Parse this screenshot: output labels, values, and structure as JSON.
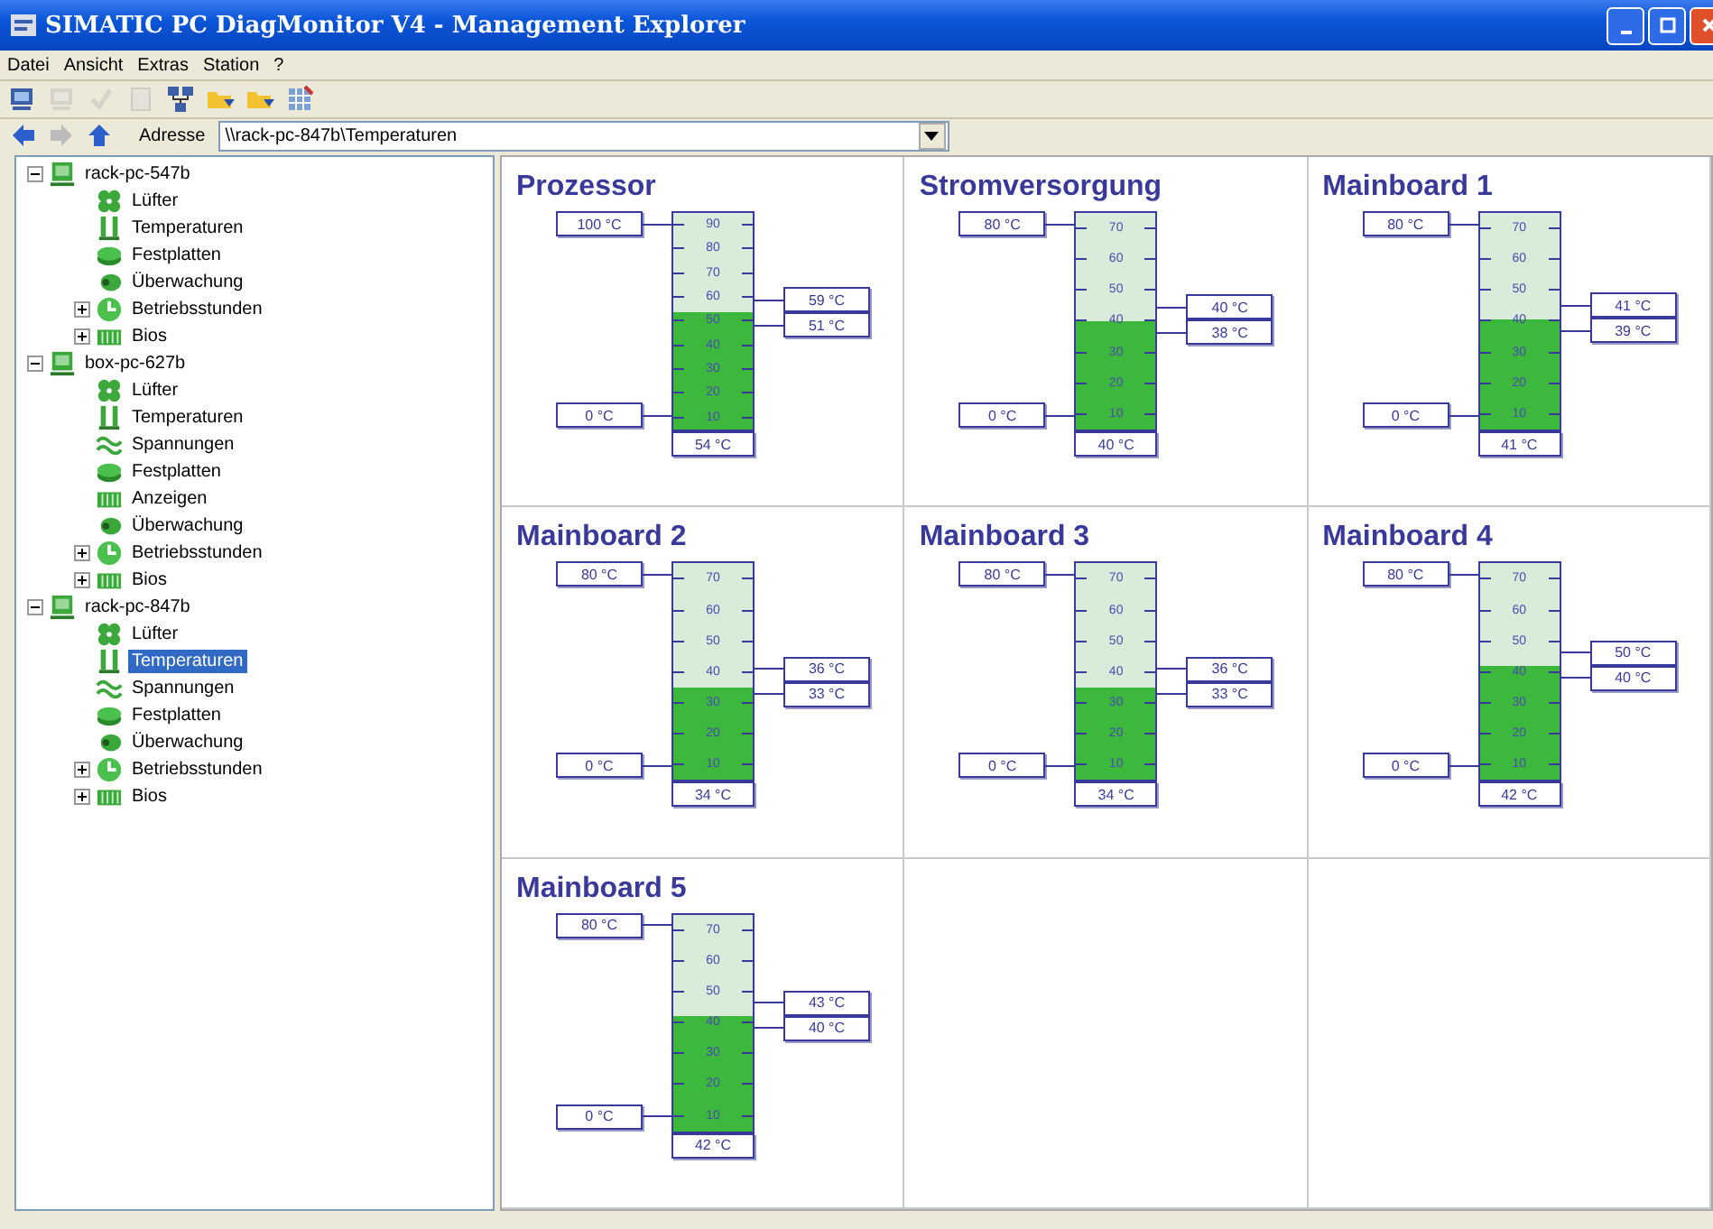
{
  "window": {
    "title": "SIMATIC PC DiagMonitor V4 - Management Explorer"
  },
  "menu": [
    "Datei",
    "Ansicht",
    "Extras",
    "Station",
    "?"
  ],
  "toolbar": [
    {
      "kind": "computer",
      "disabled": false
    },
    {
      "kind": "computer",
      "disabled": true
    },
    {
      "kind": "check",
      "disabled": true
    },
    {
      "kind": "page",
      "disabled": true
    },
    {
      "kind": "network",
      "disabled": false
    },
    {
      "kind": "folder",
      "disabled": false
    },
    {
      "kind": "folder",
      "disabled": false
    },
    {
      "kind": "grid",
      "disabled": false
    }
  ],
  "nav": [
    {
      "kind": "back",
      "disabled": false
    },
    {
      "kind": "forward",
      "disabled": true
    },
    {
      "kind": "up",
      "disabled": false
    }
  ],
  "address": {
    "label": "Adresse",
    "value": "\\\\rack-pc-847b\\Temperaturen"
  },
  "tree": [
    {
      "label": "rack-pc-547b",
      "kind": "station",
      "expanded": true,
      "selected": false,
      "children": [
        {
          "label": "Lüfter",
          "kind": "fan",
          "selected": false
        },
        {
          "label": "Temperaturen",
          "kind": "thermo",
          "selected": false
        },
        {
          "label": "Festplatten",
          "kind": "disk",
          "selected": false
        },
        {
          "label": "Überwachung",
          "kind": "watch",
          "selected": false
        },
        {
          "label": "Betriebsstunden",
          "kind": "clock",
          "expanded": false,
          "selected": false
        },
        {
          "label": "Bios",
          "kind": "bios",
          "expanded": false,
          "selected": false
        }
      ]
    },
    {
      "label": "box-pc-627b",
      "kind": "station",
      "expanded": true,
      "selected": false,
      "children": [
        {
          "label": "Lüfter",
          "kind": "fan",
          "selected": false
        },
        {
          "label": "Temperaturen",
          "kind": "thermo",
          "selected": false
        },
        {
          "label": "Spannungen",
          "kind": "wave",
          "selected": false
        },
        {
          "label": "Festplatten",
          "kind": "disk",
          "selected": false
        },
        {
          "label": "Anzeigen",
          "kind": "bios",
          "selected": false
        },
        {
          "label": "Überwachung",
          "kind": "watch",
          "selected": false
        },
        {
          "label": "Betriebsstunden",
          "kind": "clock",
          "expanded": false,
          "selected": false
        },
        {
          "label": "Bios",
          "kind": "bios",
          "expanded": false,
          "selected": false
        }
      ]
    },
    {
      "label": "rack-pc-847b",
      "kind": "station",
      "expanded": true,
      "selected": false,
      "children": [
        {
          "label": "Lüfter",
          "kind": "fan",
          "selected": false
        },
        {
          "label": "Temperaturen",
          "kind": "thermo",
          "selected": true
        },
        {
          "label": "Spannungen",
          "kind": "wave",
          "selected": false
        },
        {
          "label": "Festplatten",
          "kind": "disk",
          "selected": false
        },
        {
          "label": "Überwachung",
          "kind": "watch",
          "selected": false
        },
        {
          "label": "Betriebsstunden",
          "kind": "clock",
          "expanded": false,
          "selected": false
        },
        {
          "label": "Bios",
          "kind": "bios",
          "expanded": false,
          "selected": false
        }
      ]
    }
  ],
  "gauges": [
    {
      "title": "Prozessor",
      "max": "100 °C",
      "min": "0 °C",
      "upper": "59 °C",
      "lower": "51 °C",
      "reading": "54 °C",
      "level": 0.54,
      "scale": [
        "90",
        "80",
        "70",
        "60",
        "50",
        "40",
        "30",
        "20",
        "10"
      ]
    },
    {
      "title": "Stromversorgung",
      "max": "80 °C",
      "min": "0 °C",
      "upper": "40 °C",
      "lower": "38 °C",
      "reading": "40 °C",
      "level": 0.5,
      "scale": [
        "70",
        "60",
        "50",
        "40",
        "30",
        "20",
        "10"
      ]
    },
    {
      "title": "Mainboard 1",
      "max": "80 °C",
      "min": "0 °C",
      "upper": "41 °C",
      "lower": "39 °C",
      "reading": "41 °C",
      "level": 0.51,
      "scale": [
        "70",
        "60",
        "50",
        "40",
        "30",
        "20",
        "10"
      ]
    },
    {
      "title": "Mainboard 2",
      "max": "80 °C",
      "min": "0 °C",
      "upper": "36 °C",
      "lower": "33 °C",
      "reading": "34 °C",
      "level": 0.43,
      "scale": [
        "70",
        "60",
        "50",
        "40",
        "30",
        "20",
        "10"
      ]
    },
    {
      "title": "Mainboard 3",
      "max": "80 °C",
      "min": "0 °C",
      "upper": "36 °C",
      "lower": "33 °C",
      "reading": "34 °C",
      "level": 0.43,
      "scale": [
        "70",
        "60",
        "50",
        "40",
        "30",
        "20",
        "10"
      ]
    },
    {
      "title": "Mainboard 4",
      "max": "80 °C",
      "min": "0 °C",
      "upper": "50 °C",
      "lower": "40 °C",
      "reading": "42 °C",
      "level": 0.53,
      "scale": [
        "70",
        "60",
        "50",
        "40",
        "30",
        "20",
        "10"
      ]
    },
    {
      "title": "Mainboard 5",
      "max": "80 °C",
      "min": "0 °C",
      "upper": "43 °C",
      "lower": "40 °C",
      "reading": "42 °C",
      "level": 0.53,
      "scale": [
        "70",
        "60",
        "50",
        "40",
        "30",
        "20",
        "10"
      ]
    }
  ]
}
